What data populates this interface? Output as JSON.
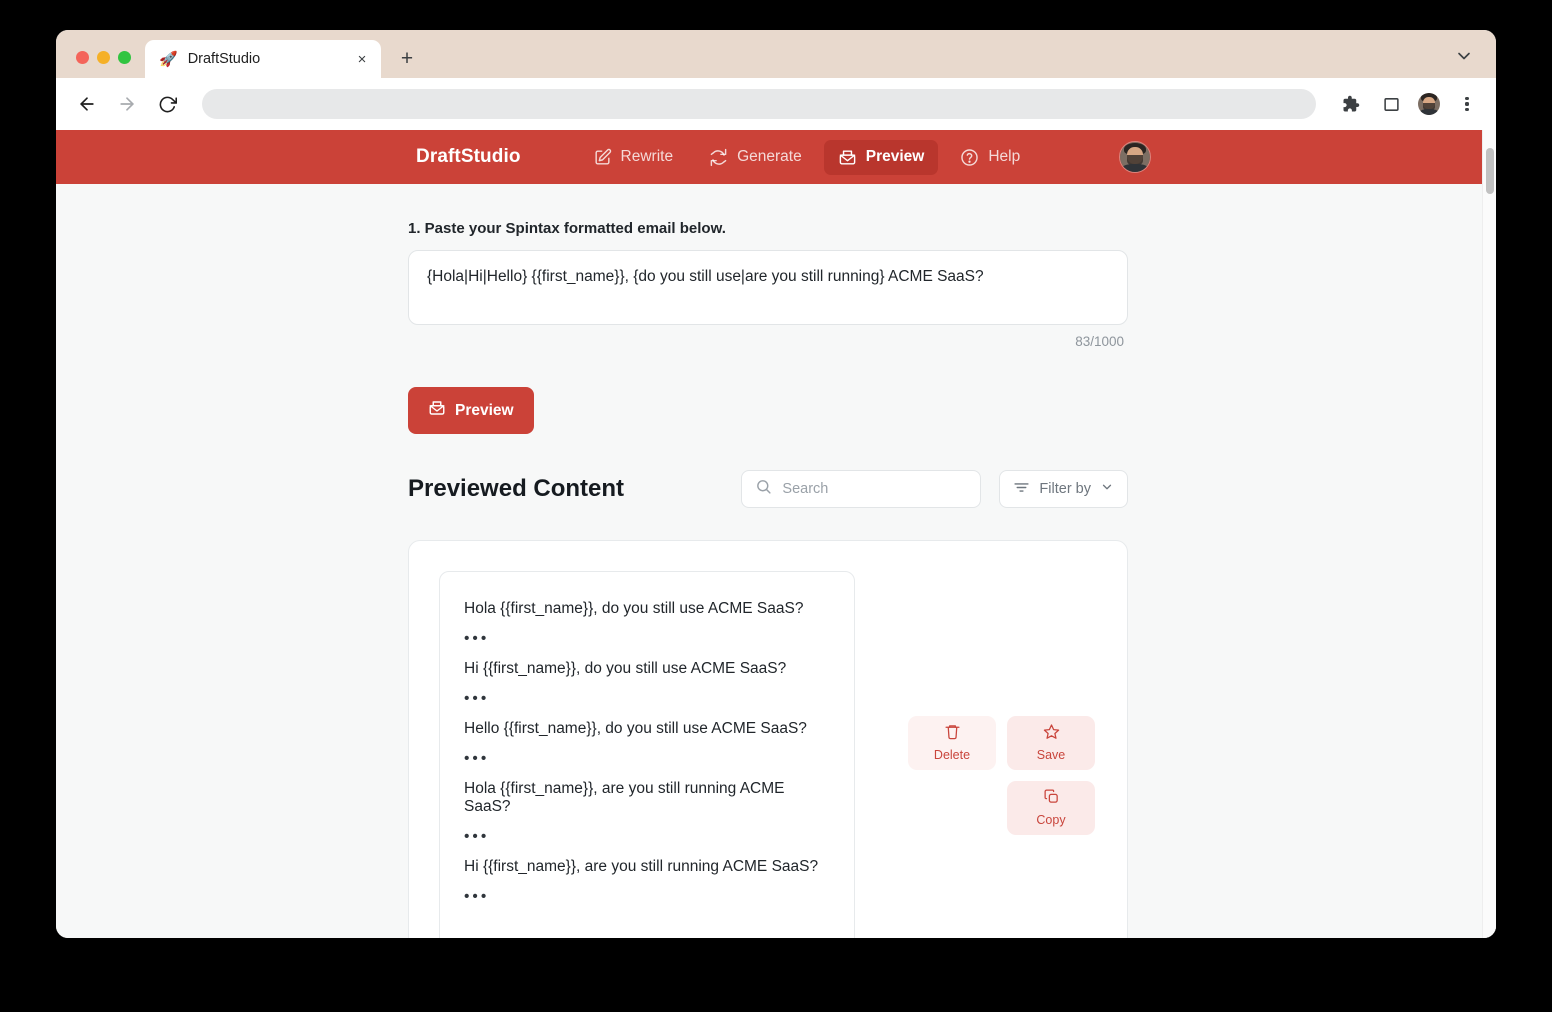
{
  "browser": {
    "tab": {
      "title": "DraftStudio",
      "favicon": "rocket-icon",
      "close_label": "×"
    },
    "new_tab_label": "+",
    "omnibox_value": "",
    "toolbar_icons": [
      "back-icon",
      "forward-icon",
      "reload-icon",
      "extensions-icon",
      "side-panel-icon",
      "profile-avatar",
      "browser-menu-icon"
    ]
  },
  "appnav": {
    "brand": "DraftStudio",
    "items": [
      {
        "label": "Rewrite",
        "icon": "pencil-square-icon",
        "active": false
      },
      {
        "label": "Generate",
        "icon": "refresh-icon",
        "active": false
      },
      {
        "label": "Preview",
        "icon": "envelope-open-icon",
        "active": true
      },
      {
        "label": "Help",
        "icon": "question-circle-icon",
        "active": false
      }
    ],
    "avatar": "user-avatar"
  },
  "form": {
    "step_label": "1. Paste your Spintax formatted email below.",
    "textarea_value": "{Hola|Hi|Hello} {{first_name}}, {do you still use|are you still running} ACME SaaS?",
    "textarea_placeholder": "",
    "char_count": "83/1000",
    "preview_button": "Preview"
  },
  "results": {
    "title": "Previewed Content",
    "search_placeholder": "Search",
    "search_value": "",
    "filter_label": "Filter by",
    "separator": "•••",
    "variants": [
      "Hola {{first_name}}, do you still use ACME SaaS?",
      "Hi {{first_name}}, do you still use ACME SaaS?",
      "Hello {{first_name}}, do you still use ACME SaaS?",
      "Hola {{first_name}}, are you still running ACME SaaS?",
      "Hi {{first_name}}, are you still running ACME SaaS?"
    ],
    "actions": [
      {
        "label": "Delete",
        "icon": "trash-icon"
      },
      {
        "label": "Save",
        "icon": "star-icon"
      },
      {
        "label": "Copy",
        "icon": "copy-icon"
      }
    ]
  },
  "colors": {
    "brand_red": "#cb4238",
    "brand_red_dark": "#b9362d",
    "action_pink": "#fbeae9",
    "page_bg": "#f7f8f8",
    "tabstrip_beige": "#e8d9cd"
  }
}
